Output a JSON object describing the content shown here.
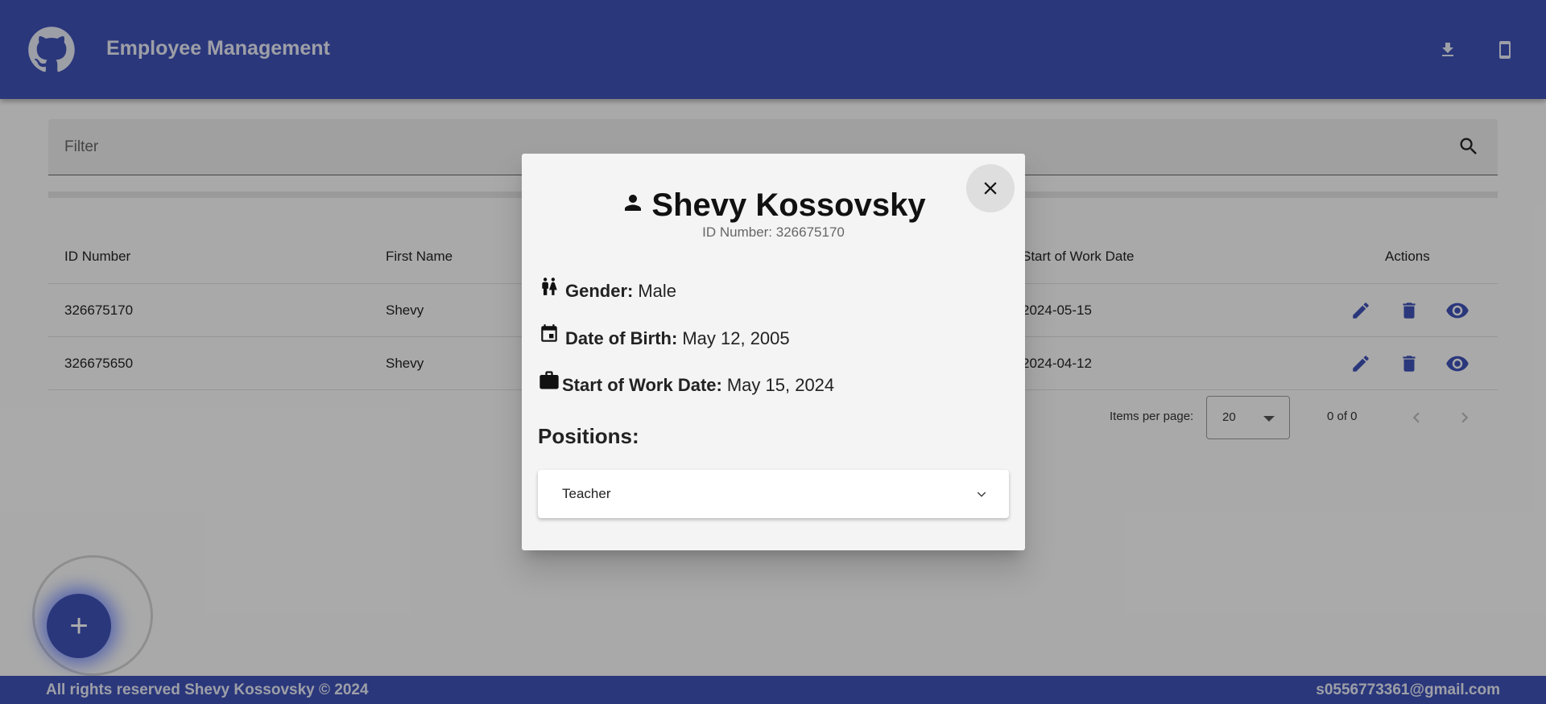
{
  "header": {
    "title": "Employee Management",
    "logo_icon": "github-icon",
    "download_icon": "download-icon",
    "mobile_icon": "mobile-device-icon",
    "brand_color": "#3f51b5"
  },
  "filter": {
    "placeholder": "Filter",
    "icon": "search-icon"
  },
  "table": {
    "columns": [
      "ID Number",
      "First Name",
      "Start of Work Date",
      "Actions"
    ],
    "rows": [
      {
        "id": "326675170",
        "first_name": "Shevy",
        "start_date": "2024-05-15"
      },
      {
        "id": "326675650",
        "first_name": "Shevy",
        "start_date": "2024-04-12"
      }
    ],
    "row_action_icons": [
      "edit-icon",
      "delete-icon",
      "view-icon"
    ]
  },
  "paginator": {
    "items_per_page_label": "Items per page:",
    "page_size": "20",
    "range": "0 of 0"
  },
  "fab": {
    "label": "+"
  },
  "footer": {
    "copyright": "All rights reserved Shevy Kossovsky © 2024",
    "email": "s0556773361@gmail.com"
  },
  "dialog": {
    "name": "Shevy Kossovsky",
    "id_line": "ID Number: 326675170",
    "gender_label": "Gender:",
    "gender_value": "Male",
    "dob_label": "Date of Birth:",
    "dob_value": "May 12, 2005",
    "start_label": "Start of Work Date:",
    "start_value": "May 15, 2024",
    "positions_title": "Positions:",
    "positions": [
      "Teacher"
    ]
  }
}
